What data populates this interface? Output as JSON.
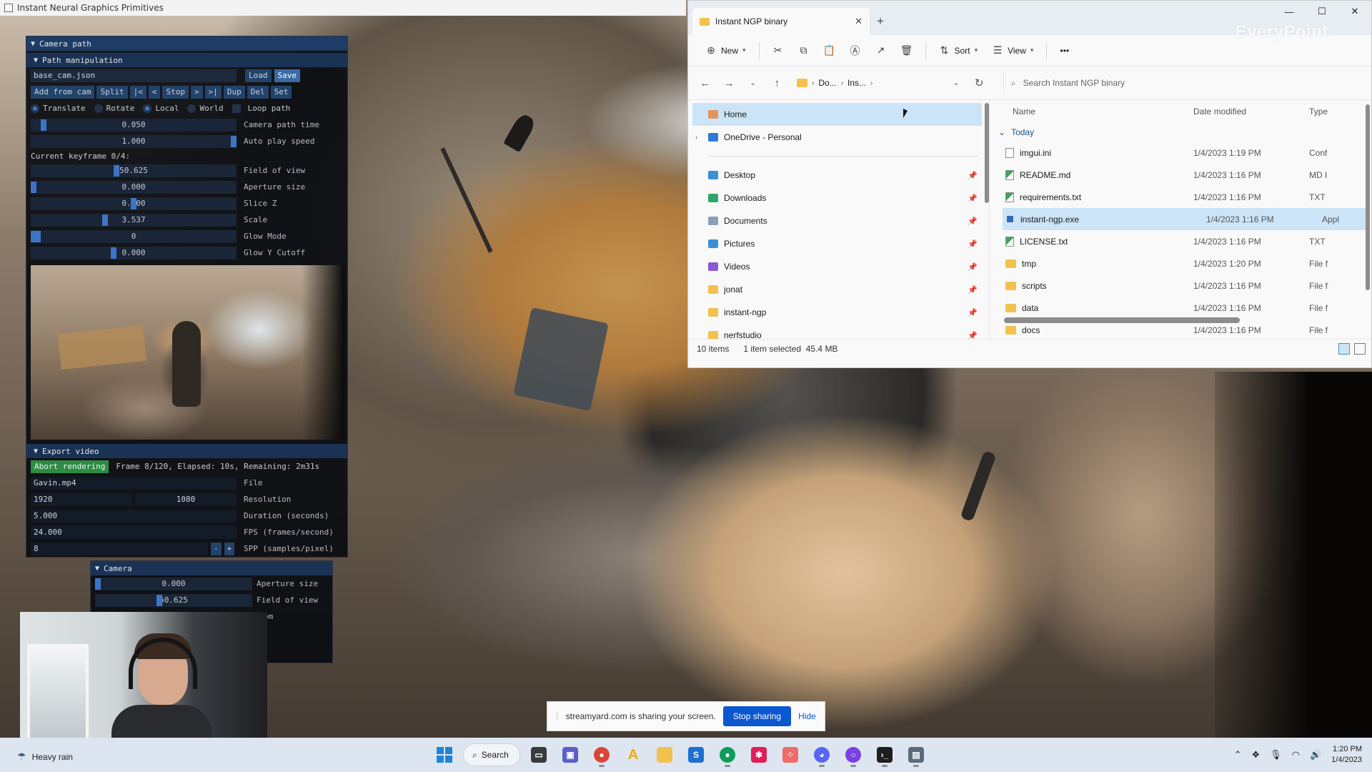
{
  "app": {
    "title": "Instant Neural Graphics Primitives"
  },
  "imgui": {
    "camera_path_header": "Camera path",
    "path_manipulation_header": "Path manipulation",
    "cam_file": "base_cam.json",
    "load": "Load",
    "save": "Save",
    "buttons": [
      "Add from cam",
      "Split",
      "|<",
      "<",
      "Stop",
      ">",
      ">|",
      "Dup",
      "Del",
      "Set"
    ],
    "radios": [
      "Translate",
      "Rotate",
      "Local",
      "World"
    ],
    "loop_path": "Loop path",
    "camera_path_time": {
      "value": "0.050",
      "label": "Camera path time"
    },
    "auto_play_speed": {
      "value": "1.000",
      "label": "Auto play speed"
    },
    "current_keyframe": "Current keyframe 0/4:",
    "field_of_view": {
      "value": "50.625",
      "label": "Field of view"
    },
    "aperture_size": {
      "value": "0.000",
      "label": "Aperture size"
    },
    "slice_z": {
      "value": "0.000",
      "label": "Slice Z"
    },
    "scale": {
      "value": "3.537",
      "label": "Scale"
    },
    "glow_mode": {
      "value": "0",
      "label": "Glow Mode"
    },
    "glow_y_cutoff": {
      "value": "0.000",
      "label": "Glow Y Cutoff"
    },
    "export_header": "Export video",
    "abort": "Abort rendering",
    "progress": "Frame 8/120, Elapsed: 10s, Remaining: 2m31s",
    "file": {
      "value": "Gavin.mp4",
      "label": "File"
    },
    "resolution": {
      "w": "1920",
      "h": "1080",
      "label": "Resolution"
    },
    "duration": {
      "value": "5.000",
      "label": "Duration (seconds)"
    },
    "fps": {
      "value": "24.000",
      "label": "FPS (frames/second)"
    },
    "spp": {
      "value": "8",
      "label": "SPP (samples/pixel)",
      "minus": "-",
      "plus": "+"
    }
  },
  "imgui2": {
    "camera_header": "Camera",
    "aperture_size": {
      "value": "0.000",
      "label": "Aperture size"
    },
    "field_of_view": {
      "value": "50.625",
      "label": "Field of view"
    },
    "partial": "om"
  },
  "explorer": {
    "tab_title": "Instant NGP binary",
    "tab_close": "✕",
    "new_tab": "+",
    "win_min": "—",
    "win_max": "☐",
    "win_close": "✕",
    "watermark": "EveryPoint",
    "new_label": "New",
    "sort_label": "Sort",
    "view_label": "View",
    "more": "•••",
    "crumbs": [
      "Do...",
      "Ins..."
    ],
    "search_placeholder": "Search Instant NGP binary",
    "nav": {
      "home": "Home",
      "onedrive": "OneDrive - Personal",
      "items": [
        "Desktop",
        "Downloads",
        "Documents",
        "Pictures",
        "Videos",
        "jonat",
        "instant-ngp",
        "nerfstudio"
      ]
    },
    "columns": {
      "name": "Name",
      "date": "Date modified",
      "type": "Type"
    },
    "group": "Today",
    "files": [
      {
        "name": "imgui.ini",
        "date": "1/4/2023 1:19 PM",
        "type": "Conf",
        "kind": "file"
      },
      {
        "name": "README.md",
        "date": "1/4/2023 1:16 PM",
        "type": "MD I",
        "kind": "md"
      },
      {
        "name": "requirements.txt",
        "date": "1/4/2023 1:16 PM",
        "type": "TXT",
        "kind": "md"
      },
      {
        "name": "instant-ngp.exe",
        "date": "1/4/2023 1:16 PM",
        "type": "Appl",
        "kind": "exe"
      },
      {
        "name": "LICENSE.txt",
        "date": "1/4/2023 1:16 PM",
        "type": "TXT",
        "kind": "md"
      },
      {
        "name": "tmp",
        "date": "1/4/2023 1:20 PM",
        "type": "File f",
        "kind": "folder"
      },
      {
        "name": "scripts",
        "date": "1/4/2023 1:16 PM",
        "type": "File f",
        "kind": "folder"
      },
      {
        "name": "data",
        "date": "1/4/2023 1:16 PM",
        "type": "File f",
        "kind": "folder"
      },
      {
        "name": "docs",
        "date": "1/4/2023 1:16 PM",
        "type": "File f",
        "kind": "folder"
      }
    ],
    "status": {
      "count": "10 items",
      "selected": "1 item selected",
      "size": "45.4 MB"
    }
  },
  "sharebar": {
    "text": "streamyard.com is sharing your screen.",
    "stop": "Stop sharing",
    "hide": "Hide"
  },
  "taskbar": {
    "weather": "Heavy rain",
    "search": "Search",
    "time": "1:20 PM",
    "date": "1/4/2023"
  },
  "colors": {
    "imgui_header": "#1d3d66",
    "imgui_accent": "#3d74c8",
    "explorer_selection": "#cce4f7",
    "share_button": "#0b57d0"
  }
}
